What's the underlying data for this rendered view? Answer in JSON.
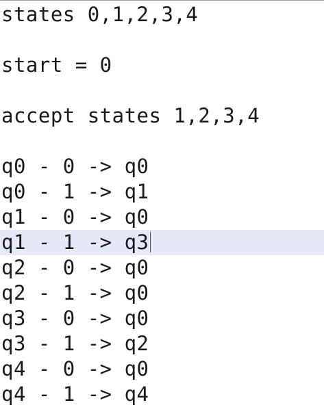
{
  "editor": {
    "lines": [
      "states 0,1,2,3,4",
      "",
      "start = 0",
      "",
      "accept states 1,2,3,4",
      "",
      "q0 - 0 -> q0",
      "q0 - 1 -> q1",
      "q1 - 0 -> q0",
      "q1 - 1 -> q3",
      "q2 - 0 -> q0",
      "q2 - 1 -> q0",
      "q3 - 0 -> q0",
      "q3 - 1 -> q2",
      "q4 - 0 -> q0",
      "q4 - 1 -> q4"
    ],
    "current_line_index": 9,
    "colors": {
      "text": "#1a1a1a",
      "current_line_highlight": "#e8e8fb",
      "caret": "#7a3fc0",
      "background": "#ffffff"
    }
  }
}
